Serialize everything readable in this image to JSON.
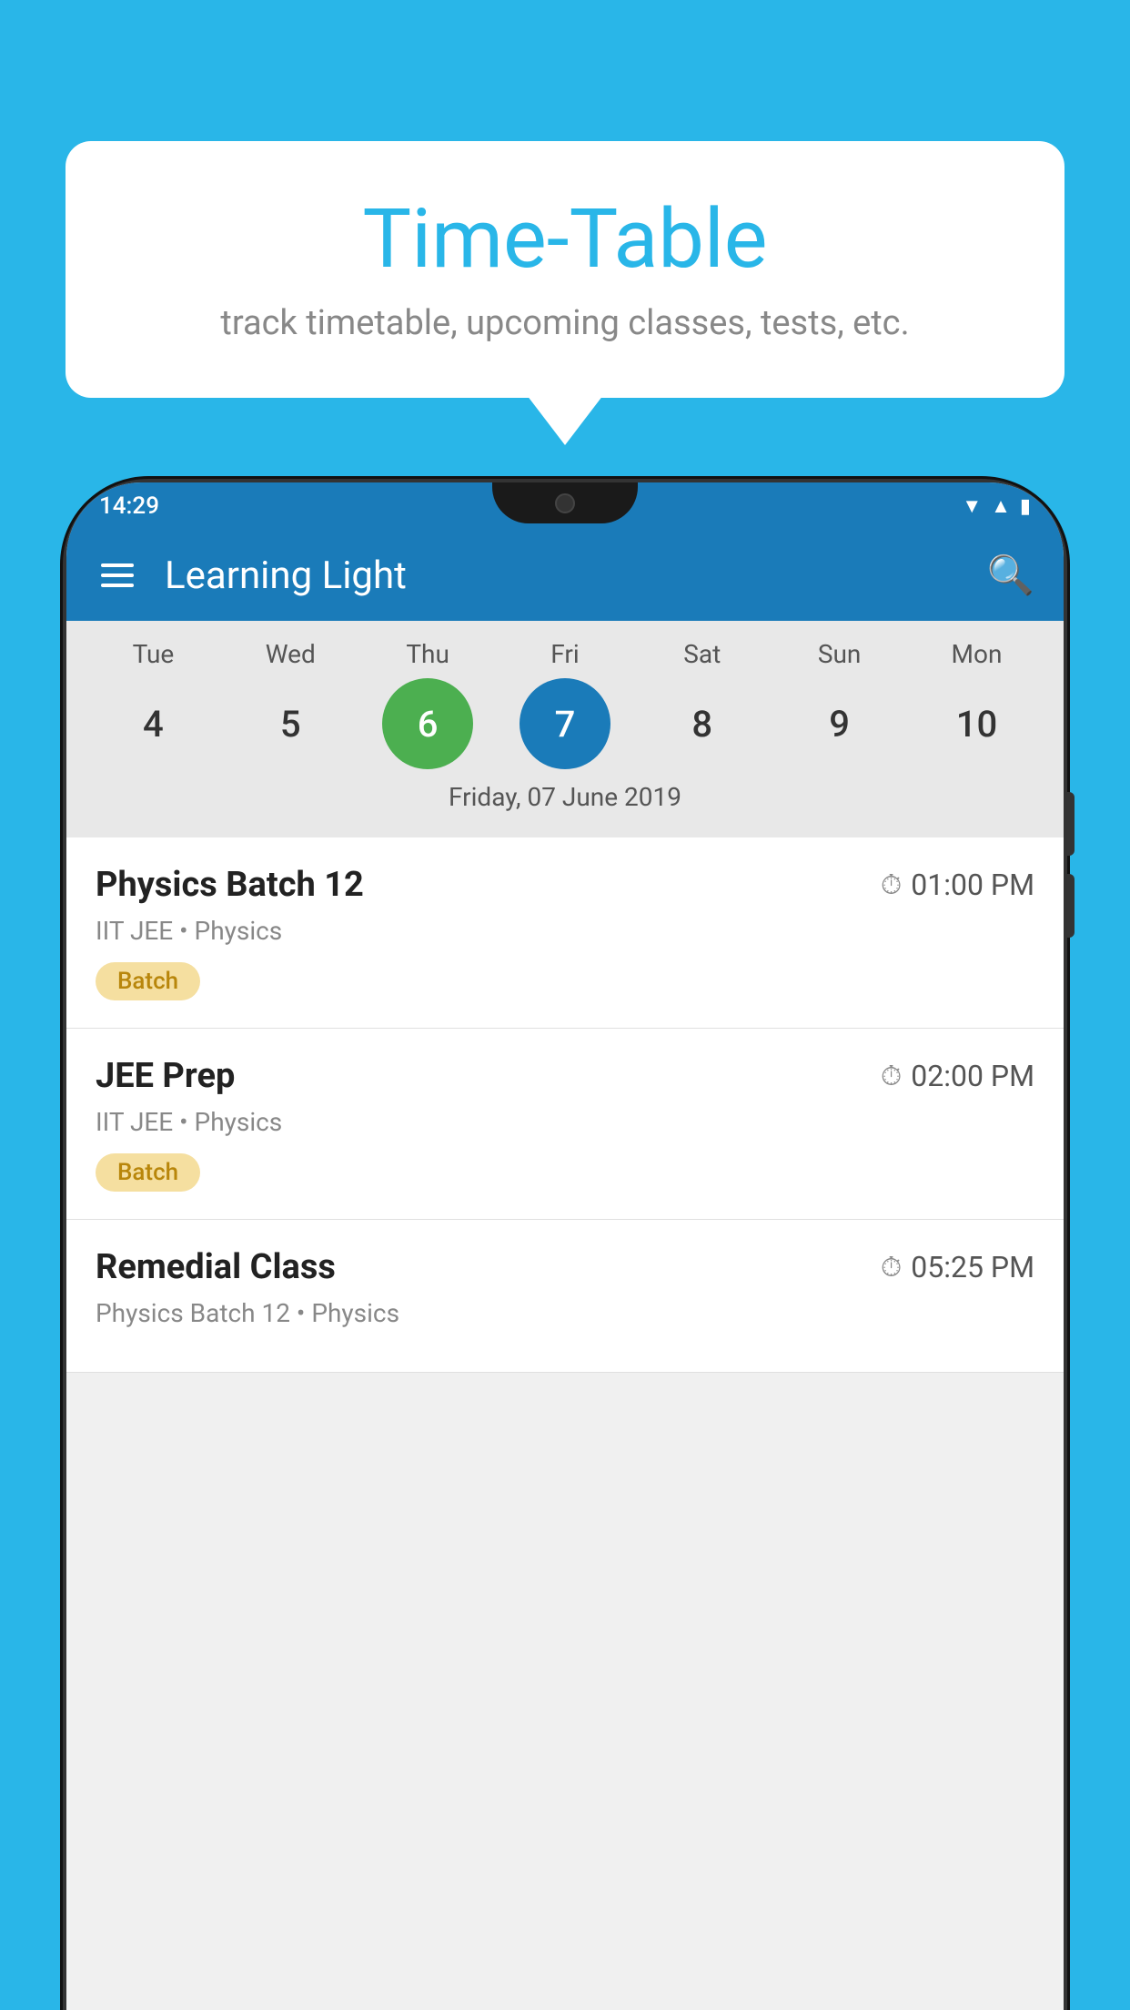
{
  "background_color": "#29b6e8",
  "bubble": {
    "title": "Time-Table",
    "subtitle": "track timetable, upcoming classes, tests, etc."
  },
  "phone": {
    "status_bar": {
      "time": "14:29"
    },
    "app_bar": {
      "title": "Learning Light"
    },
    "calendar": {
      "days": [
        {
          "name": "Tue",
          "num": "4",
          "state": "normal"
        },
        {
          "name": "Wed",
          "num": "5",
          "state": "normal"
        },
        {
          "name": "Thu",
          "num": "6",
          "state": "today"
        },
        {
          "name": "Fri",
          "num": "7",
          "state": "selected"
        },
        {
          "name": "Sat",
          "num": "8",
          "state": "normal"
        },
        {
          "name": "Sun",
          "num": "9",
          "state": "normal"
        },
        {
          "name": "Mon",
          "num": "10",
          "state": "normal"
        }
      ],
      "selected_date_label": "Friday, 07 June 2019"
    },
    "schedule": [
      {
        "name": "Physics Batch 12",
        "time": "01:00 PM",
        "subject": "IIT JEE • Physics",
        "badge": "Batch"
      },
      {
        "name": "JEE Prep",
        "time": "02:00 PM",
        "subject": "IIT JEE • Physics",
        "badge": "Batch"
      },
      {
        "name": "Remedial Class",
        "time": "05:25 PM",
        "subject": "Physics Batch 12 • Physics",
        "badge": null
      }
    ]
  }
}
